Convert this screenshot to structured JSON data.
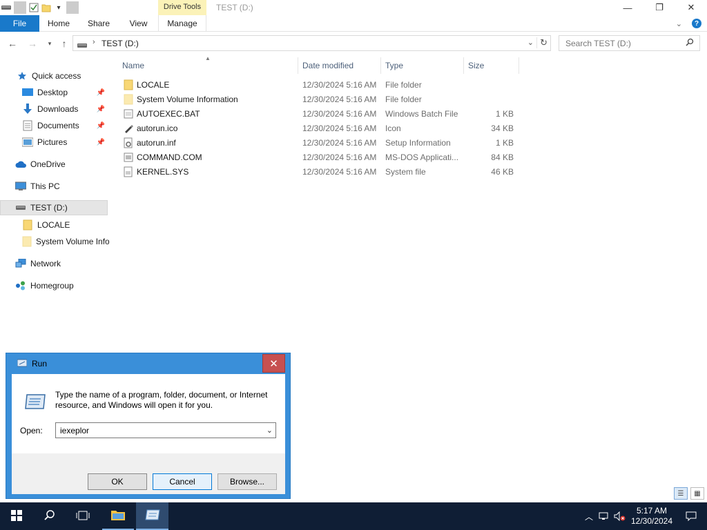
{
  "window": {
    "title": "TEST (D:)",
    "contextual_tab": "Drive Tools",
    "controls": {
      "minimize": "—",
      "maximize": "❐",
      "close": "✕"
    }
  },
  "ribbon": {
    "tabs": [
      "File",
      "Home",
      "Share",
      "View",
      "Manage"
    ]
  },
  "addressbar": {
    "path": "TEST (D:)",
    "search_placeholder": "Search TEST (D:)"
  },
  "nav_pane": {
    "quick_access": "Quick access",
    "pinned": [
      "Desktop",
      "Downloads",
      "Documents",
      "Pictures"
    ],
    "onedrive": "OneDrive",
    "this_pc": "This PC",
    "drive": "TEST (D:)",
    "drive_children": [
      "LOCALE",
      "System Volume Info"
    ],
    "network": "Network",
    "homegroup": "Homegroup"
  },
  "file_list": {
    "columns": [
      "Name",
      "Date modified",
      "Type",
      "Size"
    ],
    "rows": [
      {
        "name": "LOCALE",
        "date": "12/30/2024 5:16 AM",
        "type": "File folder",
        "size": "",
        "icon": "folder-icon"
      },
      {
        "name": "System Volume Information",
        "date": "12/30/2024 5:16 AM",
        "type": "File folder",
        "size": "",
        "icon": "folder-faded-icon"
      },
      {
        "name": "AUTOEXEC.BAT",
        "date": "12/30/2024 5:16 AM",
        "type": "Windows Batch File",
        "size": "1 KB",
        "icon": "batch-file-icon"
      },
      {
        "name": "autorun.ico",
        "date": "12/30/2024 5:16 AM",
        "type": "Icon",
        "size": "34 KB",
        "icon": "icon-file-icon"
      },
      {
        "name": "autorun.inf",
        "date": "12/30/2024 5:16 AM",
        "type": "Setup Information",
        "size": "1 KB",
        "icon": "setup-file-icon"
      },
      {
        "name": "COMMAND.COM",
        "date": "12/30/2024 5:16 AM",
        "type": "MS-DOS Applicati...",
        "size": "84 KB",
        "icon": "dos-app-icon"
      },
      {
        "name": "KERNEL.SYS",
        "date": "12/30/2024 5:16 AM",
        "type": "System file",
        "size": "46 KB",
        "icon": "system-file-icon"
      }
    ]
  },
  "run_dialog": {
    "title": "Run",
    "close": "✕",
    "description": "Type the name of a program, folder, document, or Internet resource, and Windows will open it for you.",
    "open_label": "Open:",
    "open_value": "iexeplor",
    "ok": "OK",
    "cancel": "Cancel",
    "browse": "Browse..."
  },
  "taskbar": {
    "time": "5:17 AM",
    "date": "12/30/2024"
  }
}
